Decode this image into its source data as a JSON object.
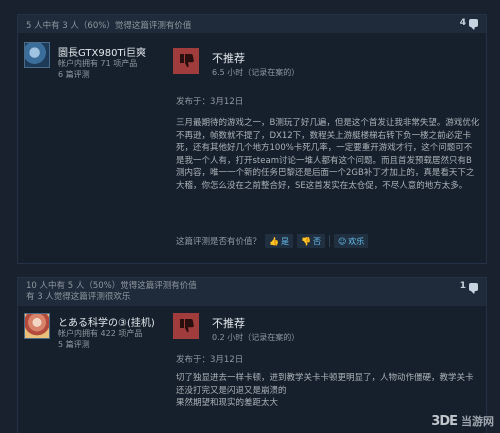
{
  "reviews": [
    {
      "helpful_text": "5 人中有 3 人（60%）觉得这篇评测有价值",
      "comment_count": "4",
      "username": "圜長GTX980Ti巨爽",
      "products": "帐户内拥有 71 项产品",
      "review_count": "6 篇评测",
      "verdict": "不推荐",
      "hours": "6.5 小时（记录在案的）",
      "posted": "发布于：3月12日",
      "body": "三月最期待的游戏之一，B测玩了好几遍，但是这个首发让我非常失望。游戏优化不再逊，帧数就不提了，DX12下，数程关上游艇楼梯右转下负一楼之前必定卡死，还有其他好几个地方100%卡死几率，一定要重开游戏才行，这个问题可不是我一个人有，打开steam讨论一堆人都有这个问题。而且首发预载居然只有B测内容，唯一一个新的任务巴黎还是后面一个2GB补丁才加上的，真是看天下之大稽，你怎么没在之前整合好，SE这首发实在太仓促，不尽人意的地方太多。",
      "vote_prompt": "这篇评测是否有价值？",
      "yes_label": "是",
      "no_label": "否",
      "funny_label": "欢乐"
    },
    {
      "helpful_text_line1": "10 人中有 5 人（50%）觉得这篇评测有价值",
      "helpful_text_line2": "有 3 人觉得这篇评测很欢乐",
      "comment_count": "1",
      "username": "とある科学の③(挂机)",
      "products": "帐户内拥有 422 项产品",
      "review_count": "5 篇评测",
      "verdict": "不推荐",
      "hours": "0.2 小时（记录在案的）",
      "posted": "发布于：3月12日",
      "body": "切了独显进去一样卡顿，进到教学关卡卡顿更明显了，人物动作僵硬，教学关卡还没打完又是闪退又是崩溃的\n果然期望和现实的差距太大"
    }
  ],
  "watermark": {
    "logo": "3DE",
    "site": "当游网"
  },
  "colors": {
    "thumb_down": "#a13c3c",
    "link": "#66c0f4",
    "background": "#1b2838"
  }
}
